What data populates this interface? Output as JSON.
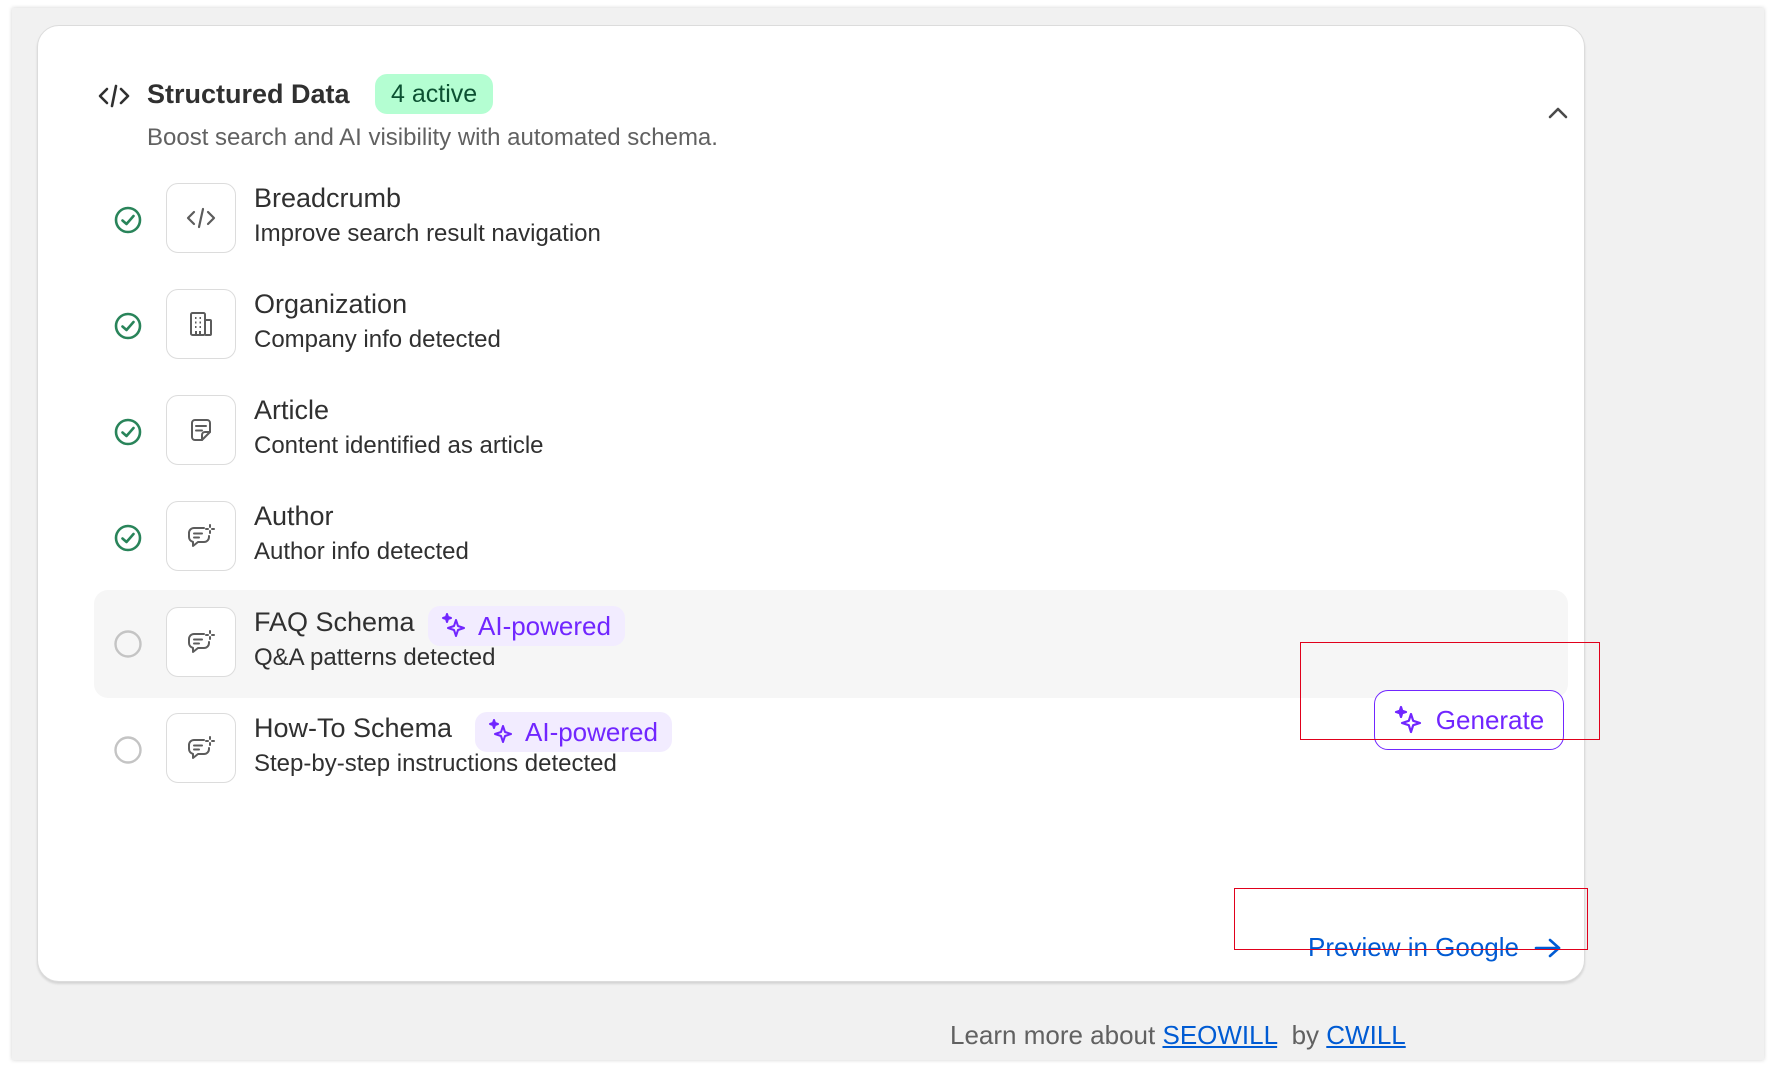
{
  "section": {
    "title": "Structured Data",
    "active_badge": "4 active",
    "subtitle": "Boost search and AI visibility with automated schema."
  },
  "items": [
    {
      "title": "Breadcrumb",
      "description": "Improve search result navigation",
      "status": "enabled",
      "icon": "code-icon"
    },
    {
      "title": "Organization",
      "description": "Company info detected",
      "status": "enabled",
      "icon": "building-icon"
    },
    {
      "title": "Article",
      "description": "Content identified as article",
      "status": "enabled",
      "icon": "note-icon"
    },
    {
      "title": "Author",
      "description": "Author info detected",
      "status": "enabled",
      "icon": "chat-sparkle-icon"
    },
    {
      "title": "FAQ Schema",
      "description": "Q&A patterns detected",
      "status": "disabled",
      "icon": "chat-sparkle-icon",
      "badge": "AI-powered"
    },
    {
      "title": "How-To Schema",
      "description": "Step-by-step instructions detected",
      "status": "disabled",
      "icon": "chat-sparkle-icon",
      "badge": "AI-powered"
    }
  ],
  "actions": {
    "generate_label": "Generate",
    "preview_label": "Preview in Google"
  },
  "footer": {
    "prefix": "Learn more about",
    "link1": "SEOWILL",
    "middle": "by",
    "link2": "CWILL"
  },
  "colors": {
    "success": "#29845a",
    "ai_purple": "#7126ff",
    "ai_badge_bg": "#f2ecff",
    "active_badge_bg": "#b4fed2",
    "link_blue": "#005bd3",
    "highlight_red": "#e0001b"
  }
}
